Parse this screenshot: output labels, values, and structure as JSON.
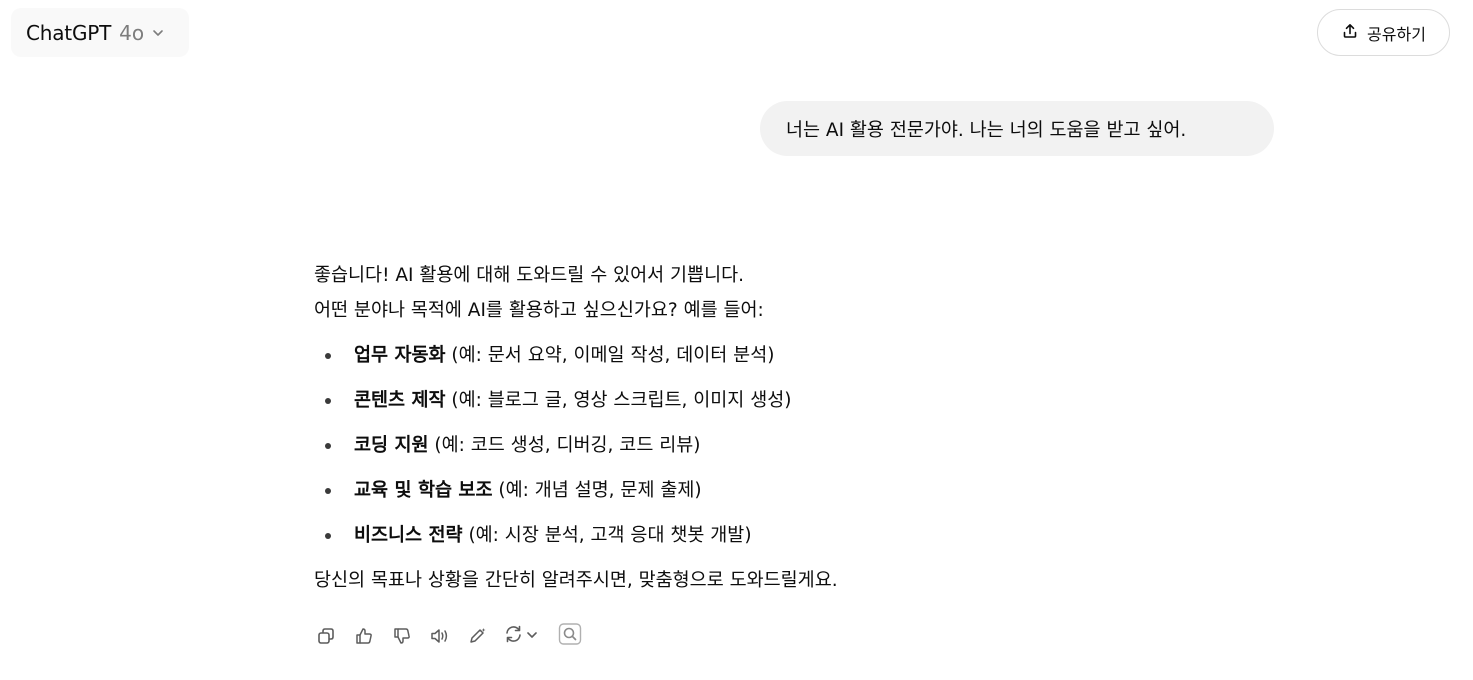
{
  "header": {
    "model_name": "ChatGPT",
    "model_version": "4o",
    "share_label": "공유하기"
  },
  "conversation": {
    "user_message": "너는 AI 활용 전문가야. 나는 너의 도움을 받고 싶어.",
    "assistant": {
      "intro_line_1": "좋습니다! AI 활용에 대해 도와드릴 수 있어서 기쁩니다.",
      "intro_line_2": "어떤 분야나 목적에 AI를 활용하고 싶으신가요? 예를 들어:",
      "bullets": [
        {
          "title": "업무 자동화",
          "detail": " (예: 문서 요약, 이메일 작성, 데이터 분석)"
        },
        {
          "title": "콘텐츠 제작",
          "detail": " (예: 블로그 글, 영상 스크립트, 이미지 생성)"
        },
        {
          "title": "코딩 지원",
          "detail": " (예: 코드 생성, 디버깅, 코드 리뷰)"
        },
        {
          "title": "교육 및 학습 보조",
          "detail": " (예: 개념 설명, 문제 출제)"
        },
        {
          "title": "비즈니스 전략",
          "detail": " (예: 시장 분석, 고객 응대 챗봇 개발)"
        }
      ],
      "closing": "당신의 목표나 상황을 간단히 알려주시면, 맞춤형으로 도와드릴게요."
    }
  },
  "toolbar": {
    "icons": [
      "copy-icon",
      "thumbs-up-icon",
      "thumbs-down-icon",
      "read-aloud-icon",
      "edit-pencil-icon",
      "regenerate-icon",
      "chevron-down-icon",
      "search-icon"
    ]
  },
  "colors": {
    "text": "#0d0d0d",
    "muted": "#7d7d7d",
    "bubble": "#f2f2f2",
    "icon": "#5d5d5d"
  }
}
